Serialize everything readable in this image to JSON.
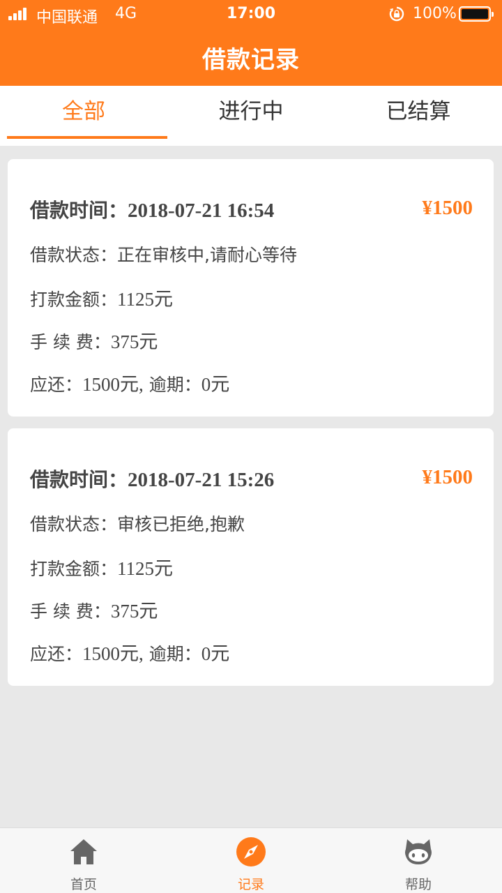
{
  "status_bar": {
    "carrier": "中国联通",
    "network": "4G",
    "time": "17:00",
    "battery": "100%"
  },
  "header": {
    "title": "借款记录"
  },
  "tabs": [
    {
      "label": "全部",
      "active": true
    },
    {
      "label": "进行中",
      "active": false
    },
    {
      "label": "已结算",
      "active": false
    }
  ],
  "records": [
    {
      "time_label": "借款时间：",
      "time_value": "2018-07-21 16:54",
      "amount": "¥1500",
      "status_label": "借款状态：",
      "status_value": "正在审核中,请耐心等待",
      "payout_label": "打款金额：",
      "payout_value": "1125元",
      "fee_label": "手 续 费：",
      "fee_value": "375元",
      "due_label": "应还：",
      "due_value": "1500元,",
      "overdue_label": "逾期：",
      "overdue_value": "0元"
    },
    {
      "time_label": "借款时间：",
      "time_value": "2018-07-21 15:26",
      "amount": "¥1500",
      "status_label": "借款状态：",
      "status_value": "审核已拒绝,抱歉",
      "payout_label": "打款金额：",
      "payout_value": "1125元",
      "fee_label": "手 续 费：",
      "fee_value": "375元",
      "due_label": "应还：",
      "due_value": "1500元,",
      "overdue_label": "逾期：",
      "overdue_value": "0元"
    }
  ],
  "bottom_nav": [
    {
      "label": "首页",
      "icon": "home-icon",
      "active": false
    },
    {
      "label": "记录",
      "icon": "compass-icon",
      "active": true
    },
    {
      "label": "帮助",
      "icon": "octocat-icon",
      "active": false
    }
  ],
  "colors": {
    "accent": "#ff7a1a",
    "background": "#e8e8e8",
    "card": "#ffffff"
  }
}
